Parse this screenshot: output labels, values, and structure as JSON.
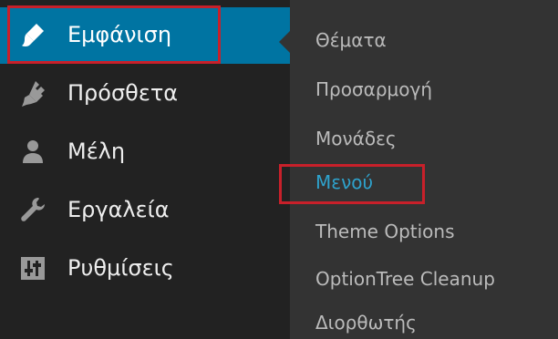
{
  "sidebar": {
    "items": [
      {
        "label": "Εμφάνιση",
        "icon": "paintbrush-icon",
        "active": true
      },
      {
        "label": "Πρόσθετα",
        "icon": "plugin-icon"
      },
      {
        "label": "Μέλη",
        "icon": "users-icon"
      },
      {
        "label": "Εργαλεία",
        "icon": "wrench-icon"
      },
      {
        "label": "Ρυθμίσεις",
        "icon": "settings-sliders-icon"
      }
    ]
  },
  "submenu": {
    "items": [
      {
        "label": "Θέματα"
      },
      {
        "label": "Προσαρμογή"
      },
      {
        "label": "Μονάδες"
      },
      {
        "label": "Μενού",
        "current": true
      },
      {
        "label": "Theme Options"
      },
      {
        "label": "OptionTree Cleanup"
      },
      {
        "label": "Διορθωτής"
      }
    ]
  },
  "colors": {
    "sidebar_bg": "#222222",
    "submenu_bg": "#333333",
    "active_bg": "#0074a2",
    "current_link": "#2ea2cc",
    "highlight_box": "#c8202a"
  }
}
